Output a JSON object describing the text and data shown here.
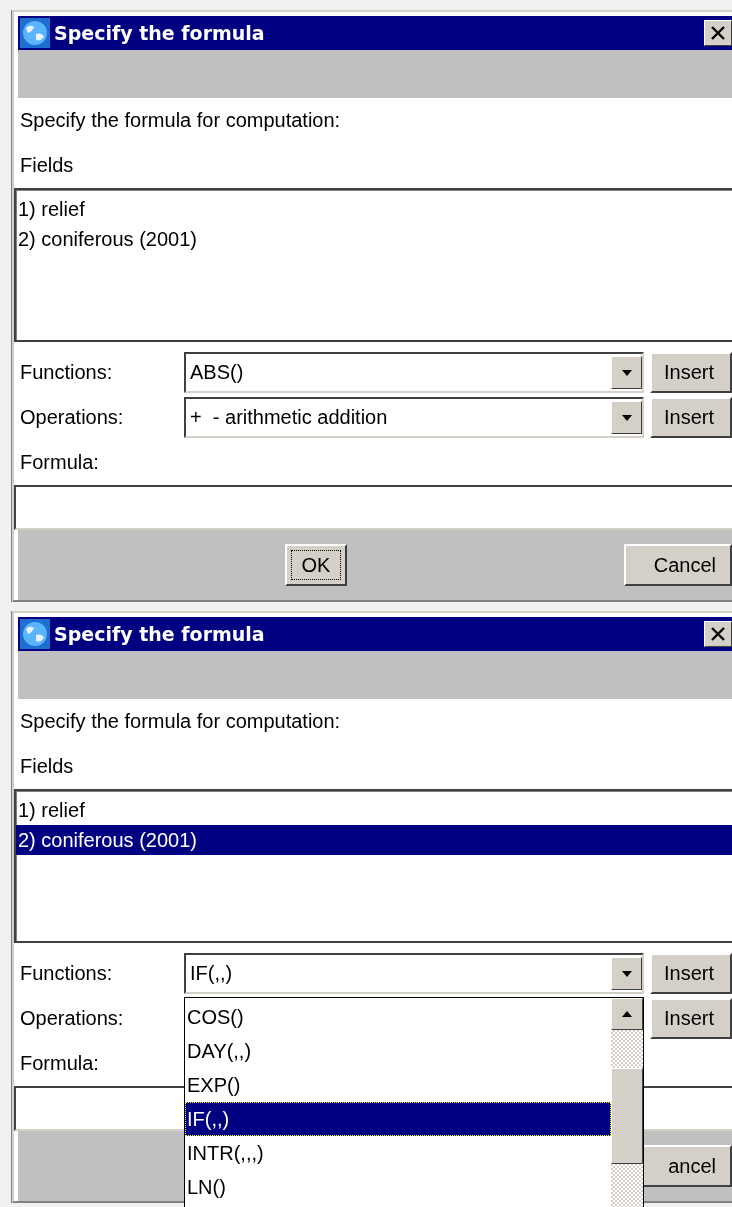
{
  "dialogs": [
    {
      "title": "Specify the formula",
      "prompt": "Specify the formula for computation:",
      "fields_label": "Fields",
      "fields": [
        {
          "text": "1) relief",
          "selected": false
        },
        {
          "text": "2) coniferous (2001)",
          "selected": false
        }
      ],
      "functions": {
        "label": "Functions:",
        "value": "ABS()",
        "button": "Insert"
      },
      "operations": {
        "label": "Operations:",
        "value": "+  - arithmetic addition",
        "button": "Insert"
      },
      "formula_label": "Formula:",
      "ok": "OK",
      "cancel": "Cancel"
    },
    {
      "title": "Specify the formula",
      "prompt": "Specify the formula for computation:",
      "fields_label": "Fields",
      "fields": [
        {
          "text": "1) relief",
          "selected": false
        },
        {
          "text": "2) coniferous (2001)",
          "selected": true
        }
      ],
      "functions": {
        "label": "Functions:",
        "value": "IF(,,)",
        "button": "Insert",
        "dropdown": [
          {
            "text": "COS()",
            "selected": false
          },
          {
            "text": "DAY(,,)",
            "selected": false
          },
          {
            "text": "EXP()",
            "selected": false
          },
          {
            "text": "IF(,,)",
            "selected": true
          },
          {
            "text": "INTR(,,,)",
            "selected": false
          },
          {
            "text": "LN()",
            "selected": false
          }
        ]
      },
      "operations": {
        "label": "Operations:",
        "button": "Insert"
      },
      "formula_label": "Formula:",
      "cancel": "ancel"
    }
  ]
}
